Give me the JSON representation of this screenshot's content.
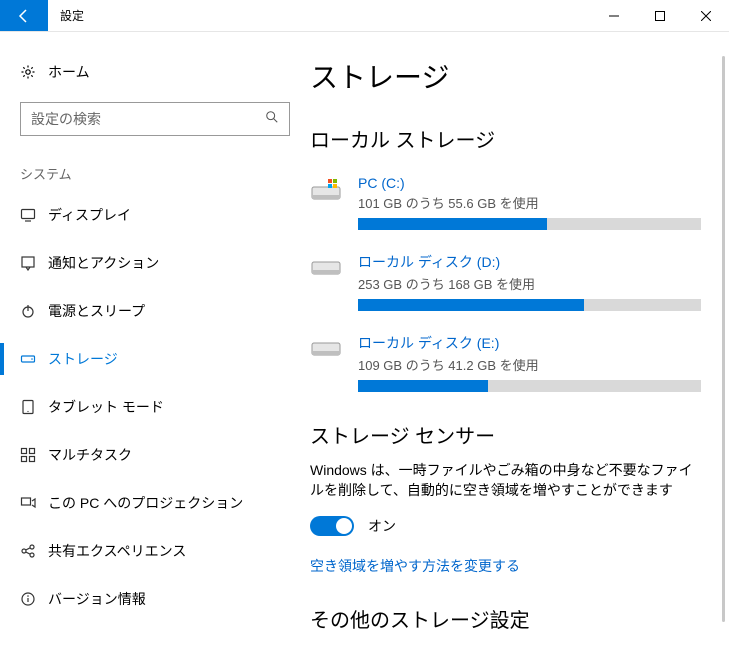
{
  "window": {
    "title": "設定"
  },
  "sidebar": {
    "home_label": "ホーム",
    "search_placeholder": "設定の検索",
    "section_label": "システム",
    "items": [
      {
        "label": "ディスプレイ"
      },
      {
        "label": "通知とアクション"
      },
      {
        "label": "電源とスリープ"
      },
      {
        "label": "ストレージ"
      },
      {
        "label": "タブレット モード"
      },
      {
        "label": "マルチタスク"
      },
      {
        "label": "この PC へのプロジェクション"
      },
      {
        "label": "共有エクスペリエンス"
      },
      {
        "label": "バージョン情報"
      }
    ]
  },
  "main": {
    "page_title": "ストレージ",
    "local_storage_heading": "ローカル ストレージ",
    "drives": [
      {
        "name": "PC (C:)",
        "usage": "101 GB のうち 55.6 GB を使用",
        "fill_pct": 55
      },
      {
        "name": "ローカル ディスク (D:)",
        "usage": "253 GB のうち 168 GB を使用",
        "fill_pct": 66
      },
      {
        "name": "ローカル ディスク (E:)",
        "usage": "109 GB のうち 41.2 GB を使用",
        "fill_pct": 38
      }
    ],
    "storage_sense_heading": "ストレージ センサー",
    "storage_sense_desc": "Windows は、一時ファイルやごみ箱の中身など不要なファイルを削除して、自動的に空き領域を増やすことができます",
    "storage_sense_toggle_state": "オン",
    "storage_sense_link": "空き領域を増やす方法を変更する",
    "other_settings_heading": "その他のストレージ設定"
  }
}
